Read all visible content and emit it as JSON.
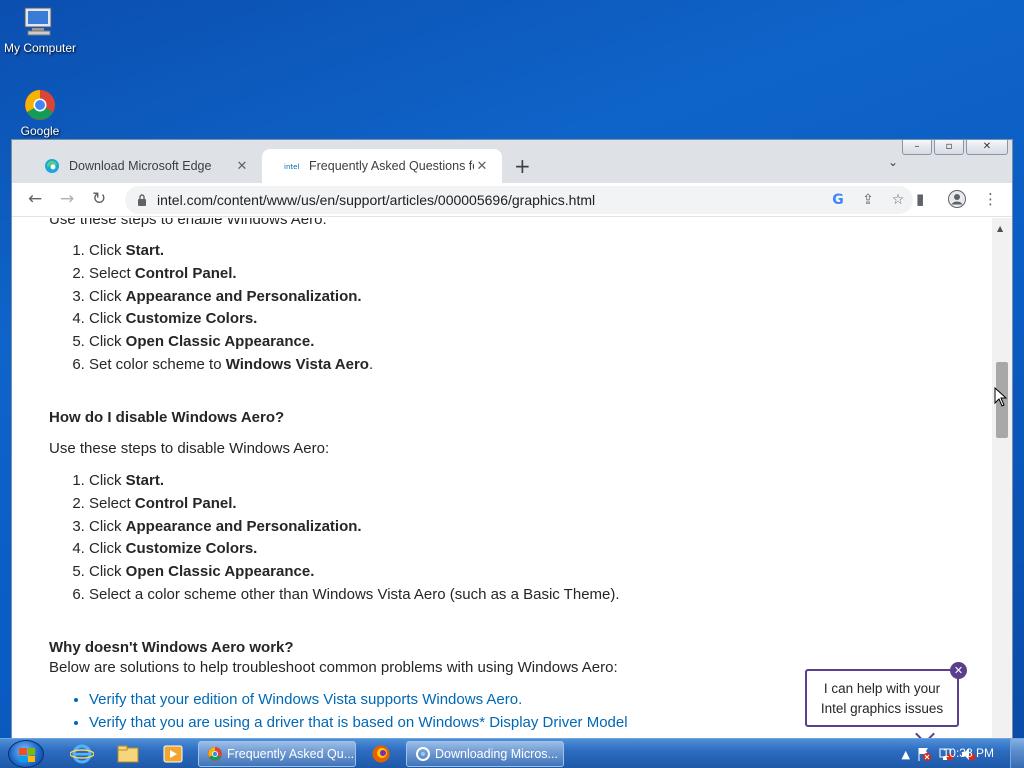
{
  "desktop": {
    "icons": [
      {
        "label": "My Computer"
      },
      {
        "label": "Google"
      }
    ]
  },
  "browser": {
    "tabs": [
      {
        "title": "Download Microsoft Edge",
        "close": "✕"
      },
      {
        "title": "Frequently Asked Questions for Windows Aero",
        "close": "✕"
      }
    ],
    "new_tab": "+",
    "tab_search": "⌄",
    "url": "intel.com/content/www/us/en/support/articles/000005696/graphics.html",
    "window_buttons": {
      "minimize": "–",
      "restore": "▫",
      "close": "✕"
    },
    "nav": {
      "back": "←",
      "forward": "→",
      "reload": "↻"
    }
  },
  "content": {
    "top_partial": "Use these steps to enable Windows Aero:",
    "enable_steps": [
      {
        "pre": "Click ",
        "bold": "Start.",
        "post": ""
      },
      {
        "pre": "Select ",
        "bold": "Control Panel.",
        "post": ""
      },
      {
        "pre": "Click ",
        "bold": "Appearance and Personalization.",
        "post": ""
      },
      {
        "pre": "Click ",
        "bold": "Customize Colors.",
        "post": ""
      },
      {
        "pre": "Click ",
        "bold": "Open Classic Appearance.",
        "post": ""
      },
      {
        "pre": "Set color scheme to ",
        "bold": "Windows Vista Aero",
        "post": "."
      }
    ],
    "disable_heading": "How do I disable Windows Aero?",
    "disable_intro": "Use these steps to disable Windows Aero:",
    "disable_steps": [
      {
        "pre": "Click ",
        "bold": "Start.",
        "post": ""
      },
      {
        "pre": "Select ",
        "bold": "Control Panel.",
        "post": ""
      },
      {
        "pre": "Click ",
        "bold": "Appearance and Personalization.",
        "post": ""
      },
      {
        "pre": "Click ",
        "bold": "Customize Colors.",
        "post": ""
      },
      {
        "pre": "Click ",
        "bold": "Open Classic Appearance.",
        "post": ""
      },
      {
        "pre": "Select a color scheme other than Windows Vista Aero (such as a Basic Theme).",
        "bold": "",
        "post": ""
      }
    ],
    "why_heading": "Why doesn't Windows Aero work?",
    "why_intro": "Below are solutions to help troubleshoot common problems with using Windows Aero:",
    "solutions": [
      "Verify that your edition of Windows Vista supports Windows Aero.",
      "Verify that you are using a driver that is based on Windows* Display Driver Model"
    ]
  },
  "chat": {
    "line1": "I can help with your",
    "line2": "Intel graphics issues",
    "close": "✕"
  },
  "taskbar": {
    "tasks": [
      {
        "label": "Frequently Asked Qu..."
      },
      {
        "label": "Downloading Micros..."
      }
    ],
    "clock": "10:38 PM",
    "tray_arrow": "▲"
  },
  "colors": {
    "link": "#0068b5",
    "chat_accent": "#5b3f8c",
    "taskbar": "#2d6cc0"
  }
}
